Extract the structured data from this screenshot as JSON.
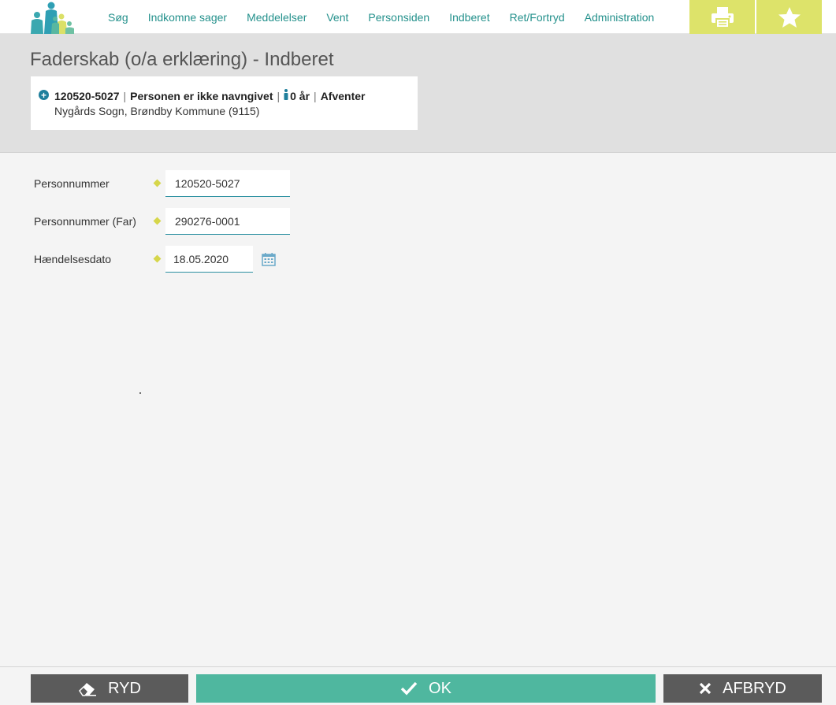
{
  "nav": {
    "items": [
      "Søg",
      "Indkomne sager",
      "Meddelelser",
      "Vent",
      "Personsiden",
      "Indberet",
      "Ret/Fortryd",
      "Administration"
    ]
  },
  "toolbar": {
    "print_icon": "print-icon",
    "star_icon": "star-icon"
  },
  "page": {
    "title": "Faderskab (o/a erklæring) - Indberet"
  },
  "person": {
    "cpr": "120520-5027",
    "name": "Personen er ikke navngivet",
    "age": "0 år",
    "status": "Afventer",
    "address": "Nygårds Sogn, Brøndby Kommune (9115)",
    "separator": "|"
  },
  "form": {
    "personnummer_label": "Personnummer",
    "personnummer_value": "120520-5027",
    "far_label": "Personnummer (Far)",
    "far_value": "290276-0001",
    "dato_label": "Hændelsesdato",
    "dato_value": "18.05.2020"
  },
  "actions": {
    "clear_label": "RYD",
    "ok_label": "OK",
    "cancel_label": "AFBRYD"
  },
  "colors": {
    "accent": "#24918c",
    "tool_bg": "#dde36a",
    "ok_bg": "#4fb79f",
    "dark_btn": "#5b5b5b"
  }
}
